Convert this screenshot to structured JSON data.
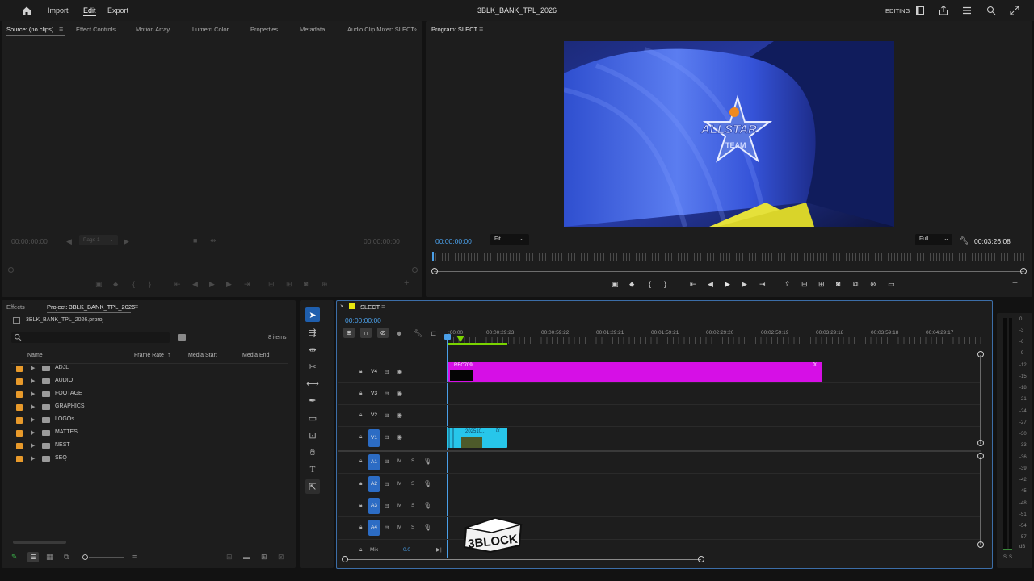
{
  "app": {
    "menu": [
      "Import",
      "Edit",
      "Export"
    ],
    "project_title": "3BLK_BANK_TPL_2026",
    "workspace": "EDITING"
  },
  "source_panel": {
    "tabs": [
      "Source: (no clips)",
      "Effect Controls",
      "Motion Array",
      "Lumetri Color",
      "Properties",
      "Metadata",
      "Audio Clip Mixer: SLECT"
    ],
    "timecode_left": "00:00:00:00",
    "page_select": "Page 1",
    "timecode_right": "00:00:00:00"
  },
  "program_panel": {
    "title": "Program: SLECT",
    "timecode": "00:00:00:00",
    "fit": "Fit",
    "quality": "Full",
    "duration": "00:03:26:08",
    "video_text": "ALLSTAR TEAM"
  },
  "project_panel": {
    "tabs": [
      "Effects",
      "Project: 3BLK_BANK_TPL_2026"
    ],
    "file": "3BLK_BANK_TPL_2026.prproj",
    "item_count": "8 items",
    "columns": [
      "Name",
      "Frame Rate",
      "Media Start",
      "Media End"
    ],
    "items": [
      {
        "name": "ADJL"
      },
      {
        "name": "AUDIO"
      },
      {
        "name": "FOOTAGE"
      },
      {
        "name": "GRAPHICS"
      },
      {
        "name": "LOGOs"
      },
      {
        "name": "MATTES"
      },
      {
        "name": "NEST"
      },
      {
        "name": "SEQ"
      }
    ],
    "folder_color": "#e89a2b"
  },
  "timeline": {
    "sequence": "SLECT",
    "timecode": "00:00:00:00",
    "ruler": [
      ":00:00",
      "00:00:29:23",
      "00:00:59:22",
      "00:01:29:21",
      "00:01:59:21",
      "00:02:29:20",
      "00:02:59:19",
      "00:03:29:18",
      "00:03:59:18",
      "00:04:29:17"
    ],
    "video_tracks": [
      "V4",
      "V3",
      "V2",
      "V1"
    ],
    "audio_tracks": [
      "A1",
      "A2",
      "A3",
      "A4"
    ],
    "mute": "M",
    "solo": "S",
    "mix_label": "Mix",
    "mix_value": "0.0",
    "clip_v4_name": "REC709",
    "clip_v1_name": "202510...",
    "fx": "fx",
    "clip_colors": {
      "adjustment": "#d60fe6",
      "video": "#27c6ea"
    },
    "watermark": "3BLOCK"
  },
  "audio_meter": {
    "scale": [
      "0",
      "-3",
      "-6",
      "-9",
      "-12",
      "-15",
      "-18",
      "-21",
      "-24",
      "-27",
      "-30",
      "-33",
      "-36",
      "-39",
      "-42",
      "-45",
      "-48",
      "-51",
      "-54",
      "-57",
      "dB"
    ],
    "solo": [
      "S",
      "S"
    ]
  }
}
